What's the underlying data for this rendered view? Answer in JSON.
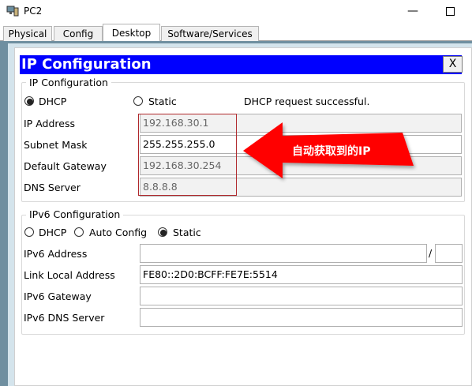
{
  "window": {
    "title": "PC2",
    "minimize_glyph": "—",
    "maximize_glyph": "☐"
  },
  "tabs": [
    {
      "label": "Physical"
    },
    {
      "label": "Config"
    },
    {
      "label": "Desktop",
      "active": true
    },
    {
      "label": "Software/Services"
    }
  ],
  "dialog": {
    "title": "IP Configuration",
    "close_label": "X"
  },
  "ipv4": {
    "group_label": "IP Configuration",
    "dhcp_label": "DHCP",
    "static_label": "Static",
    "selected_mode": "DHCP",
    "status": "DHCP request successful.",
    "fields": [
      {
        "label": "IP Address",
        "value": "192.168.30.1"
      },
      {
        "label": "Subnet Mask",
        "value": "255.255.255.0"
      },
      {
        "label": "Default Gateway",
        "value": "192.168.30.254"
      },
      {
        "label": "DNS Server",
        "value": "8.8.8.8"
      }
    ]
  },
  "ipv6": {
    "group_label": "IPv6 Configuration",
    "dhcp_label": "DHCP",
    "auto_label": "Auto Config",
    "static_label": "Static",
    "selected_mode": "Static",
    "address_label": "IPv6 Address",
    "address_value": "",
    "prefix_separator": "/",
    "prefix_value": "",
    "link_local_label": "Link Local Address",
    "link_local_value": "FE80::2D0:BCFF:FE7E:5514",
    "gateway_label": "IPv6 Gateway",
    "gateway_value": "",
    "dns_label": "IPv6 DNS Server",
    "dns_value": ""
  },
  "annotation": {
    "text": "自动获取到的IP",
    "arrow_color": "#ff0000",
    "box_color": "#b0282c"
  },
  "colors": {
    "header_bg": "#0000ff",
    "frame": "#6f8fa0"
  }
}
